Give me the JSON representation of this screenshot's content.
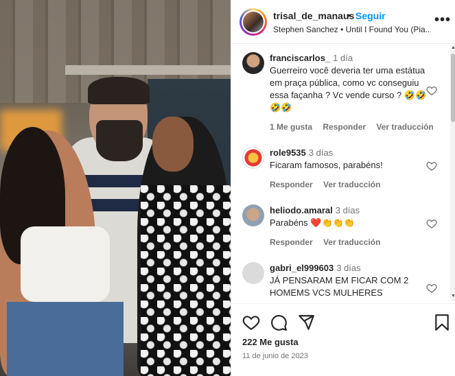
{
  "post": {
    "username": "trisal_de_manaus",
    "separator": "•",
    "follow_label": "Seguir",
    "song": "Stephen Sanchez • Until I Found You (Pia...",
    "more_label": "•••"
  },
  "comments": [
    {
      "user": "franciscarlos_",
      "time": "1 día",
      "text": "Guerreiro você deveria ter uma estátua em praça pública, como vc conseguiu essa façanha ? Vc vende curso ? 🤣🤣🤣🤣",
      "likes": "1 Me gusta",
      "reply": "Responder",
      "translate": "Ver traducción"
    },
    {
      "user": "role9535",
      "time": "3 días",
      "text": "Ficaram famosos, parabéns!",
      "reply": "Responder",
      "translate": "Ver traducción"
    },
    {
      "user": "heliodo.amaral",
      "time": "3 días",
      "text": "Parabéns ❤️👏👏👏",
      "reply": "Responder",
      "translate": "Ver traducción"
    },
    {
      "user": "gabri_el999603",
      "time": "3 días",
      "text": "JÁ PENSARAM EM FICAR COM 2 HOMEMS VCS MULHERES"
    }
  ],
  "footer": {
    "likes": "222 Me gusta",
    "date": "11 de junio de 2023"
  },
  "colors": {
    "accent": "#0095f6",
    "muted": "#737373",
    "text": "#262626"
  },
  "icons": [
    "heart-icon",
    "comment-icon",
    "share-icon",
    "bookmark-icon",
    "more-icon"
  ]
}
